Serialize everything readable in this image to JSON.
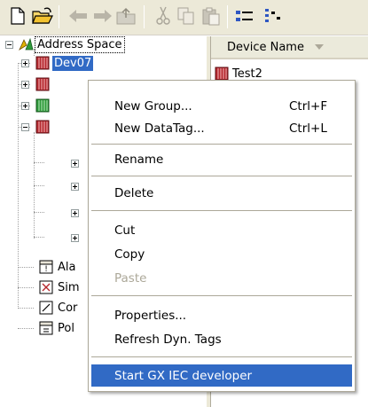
{
  "toolbar": {
    "buttons": [
      {
        "name": "new-icon"
      },
      {
        "name": "open-folder-icon"
      },
      {
        "name": "back-arrow-icon"
      },
      {
        "name": "forward-arrow-icon"
      },
      {
        "name": "up-folder-icon"
      },
      {
        "name": "cut-icon"
      },
      {
        "name": "copy-icon"
      },
      {
        "name": "paste-icon"
      },
      {
        "name": "small-icons-view-icon"
      },
      {
        "name": "list-view-icon"
      }
    ]
  },
  "tree": {
    "root_label": "Address Space",
    "selected_device": "Dev07",
    "partial_labels": [
      "Ala",
      "Sim",
      "Cor",
      "Pol"
    ]
  },
  "list": {
    "column_header": "Device Name",
    "rows": [
      {
        "label": "Test2"
      }
    ]
  },
  "context_menu": {
    "items": [
      {
        "label": "New Group...",
        "shortcut": "Ctrl+F"
      },
      {
        "label": "New DataTag...",
        "shortcut": "Ctrl+L"
      },
      {
        "label": "Rename"
      },
      {
        "label": "Delete"
      },
      {
        "label": "Cut"
      },
      {
        "label": "Copy"
      },
      {
        "label": "Paste",
        "disabled": true
      },
      {
        "label": "Properties..."
      },
      {
        "label": "Refresh Dyn. Tags"
      },
      {
        "label": "Start GX IEC developer",
        "highlighted": true
      }
    ]
  },
  "colors": {
    "selection": "#316ac5",
    "toolbar_bg": "#ece9d8",
    "disabled_text": "#aca899",
    "device_red": "#b5282e",
    "device_green": "#2e9a3a"
  }
}
